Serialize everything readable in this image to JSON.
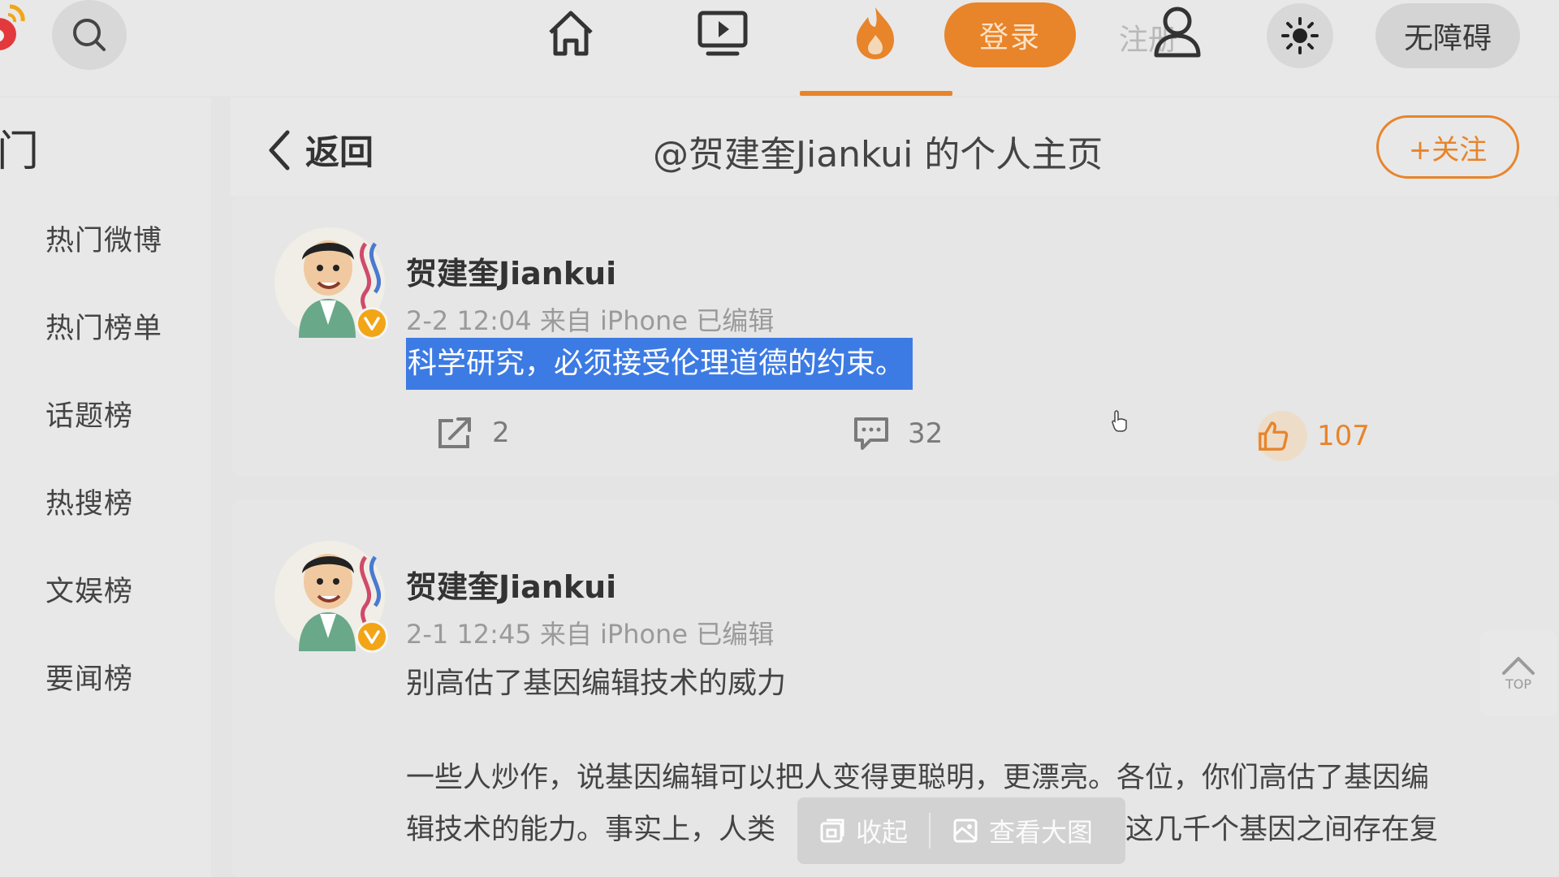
{
  "header": {
    "login_label": "登录",
    "register_label": "注册",
    "accessibility_label": "无障碍"
  },
  "sidebar": {
    "heading": "门",
    "items": [
      {
        "label": "热门微博"
      },
      {
        "label": "热门榜单"
      },
      {
        "label": "话题榜"
      },
      {
        "label": "热搜榜"
      },
      {
        "label": "文娱榜"
      },
      {
        "label": "要闻榜"
      }
    ]
  },
  "page": {
    "back_label": "返回",
    "title": "@贺建奎Jiankui 的个人主页",
    "follow_label": "+关注"
  },
  "posts": [
    {
      "author": "贺建奎Jiankui",
      "meta": "2-2 12:04  来自 iPhone 已编辑",
      "text": "科学研究，必须接受伦理道德的约束。",
      "reposts": "2",
      "comments": "32",
      "likes": "107"
    },
    {
      "author": "贺建奎Jiankui",
      "meta": "2-1 12:45  来自 iPhone 已编辑",
      "text": "别高估了基因编辑技术的威力",
      "body_line1": "一些人炒作，说基因编辑可以把人变得更聪明，更漂亮。各位，你们高估了基因编",
      "body_line2": "辑技术的能力。事实上，人类",
      "body_line2_end": "，这几千个基因之间存在复"
    }
  ],
  "image_toolbar": {
    "collapse_label": "收起",
    "view_large_label": "查看大图"
  },
  "back_to_top_label": "TOP",
  "colors": {
    "accent": "#e8842a",
    "selection": "#3d7be4",
    "verified": "#f2a516"
  }
}
